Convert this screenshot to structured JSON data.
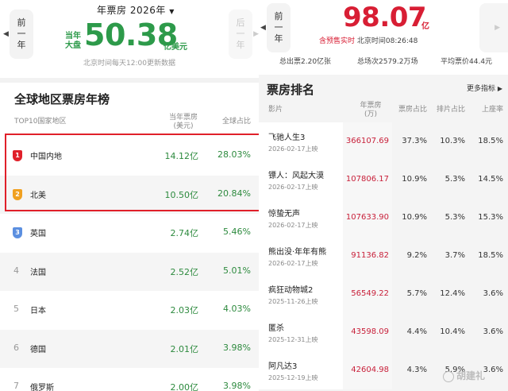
{
  "colors": {
    "green": "#2d9a4a",
    "red": "#d81e34",
    "highlight": "#e0202a"
  },
  "left": {
    "nav_prev": [
      "前",
      "一",
      "年"
    ],
    "nav_next": [
      "后",
      "一",
      "年"
    ],
    "year_label": "年票房 2026年",
    "cum_label": "当年大盘",
    "total": "50.38",
    "unit": "亿美元",
    "update_note": "北京时间每天12:00更新数据",
    "title": "全球地区票房年榜",
    "headers": {
      "region": "TOP10国家地区",
      "box": "当年票房",
      "box_unit": "(美元)",
      "share": "全球占比"
    },
    "rows": [
      {
        "rank": "1",
        "name": "中国内地",
        "value": "14.12亿",
        "share": "28.03%"
      },
      {
        "rank": "2",
        "name": "北美",
        "value": "10.50亿",
        "share": "20.84%"
      },
      {
        "rank": "3",
        "name": "英国",
        "value": "2.74亿",
        "share": "5.46%"
      },
      {
        "rank": "4",
        "name": "法国",
        "value": "2.52亿",
        "share": "5.01%"
      },
      {
        "rank": "5",
        "name": "日本",
        "value": "2.03亿",
        "share": "4.03%"
      },
      {
        "rank": "6",
        "name": "德国",
        "value": "2.01亿",
        "share": "3.98%"
      },
      {
        "rank": "7",
        "name": "俄罗斯",
        "value": "2.00亿",
        "share": "3.98%"
      }
    ]
  },
  "right": {
    "nav_prev": [
      "前",
      "一",
      "年"
    ],
    "total": "98.07",
    "unit": "亿",
    "realtime_label": "含预售实时",
    "time_label": "北京时间08:26:48",
    "stats": {
      "tickets": "总出票2.20亿张",
      "shows": "总场次2579.2万场",
      "avg": "平均票价44.4元"
    },
    "title": "票房排名",
    "more": "更多指标",
    "headers": {
      "movie": "影片",
      "box": "年票房",
      "box_unit": "(万)",
      "share": "票房占比",
      "screen": "排片占比",
      "seat": "上座率"
    },
    "rows": [
      {
        "name": "飞驰人生3",
        "date": "2026-02-17上映",
        "box": "366107.69",
        "share": "37.3%",
        "screen": "10.3%",
        "seat": "18.5%"
      },
      {
        "name": "镖人：风起大漠",
        "date": "2026-02-17上映",
        "box": "107806.17",
        "share": "10.9%",
        "screen": "5.3%",
        "seat": "14.5%"
      },
      {
        "name": "惊蛰无声",
        "date": "2026-02-17上映",
        "box": "107633.90",
        "share": "10.9%",
        "screen": "5.3%",
        "seat": "15.3%"
      },
      {
        "name": "熊出没·年年有熊",
        "date": "2026-02-17上映",
        "box": "91136.82",
        "share": "9.2%",
        "screen": "3.7%",
        "seat": "18.5%"
      },
      {
        "name": "疯狂动物城2",
        "date": "2025-11-26上映",
        "box": "56549.22",
        "share": "5.7%",
        "screen": "12.4%",
        "seat": "3.6%"
      },
      {
        "name": "匿杀",
        "date": "2025-12-31上映",
        "box": "43598.09",
        "share": "4.4%",
        "screen": "10.4%",
        "seat": "3.6%"
      },
      {
        "name": "阿凡达3",
        "date": "2025-12-19上映",
        "box": "42604.98",
        "share": "4.3%",
        "screen": "5.9%",
        "seat": "3.6%"
      }
    ]
  },
  "watermark": "胡建礼"
}
